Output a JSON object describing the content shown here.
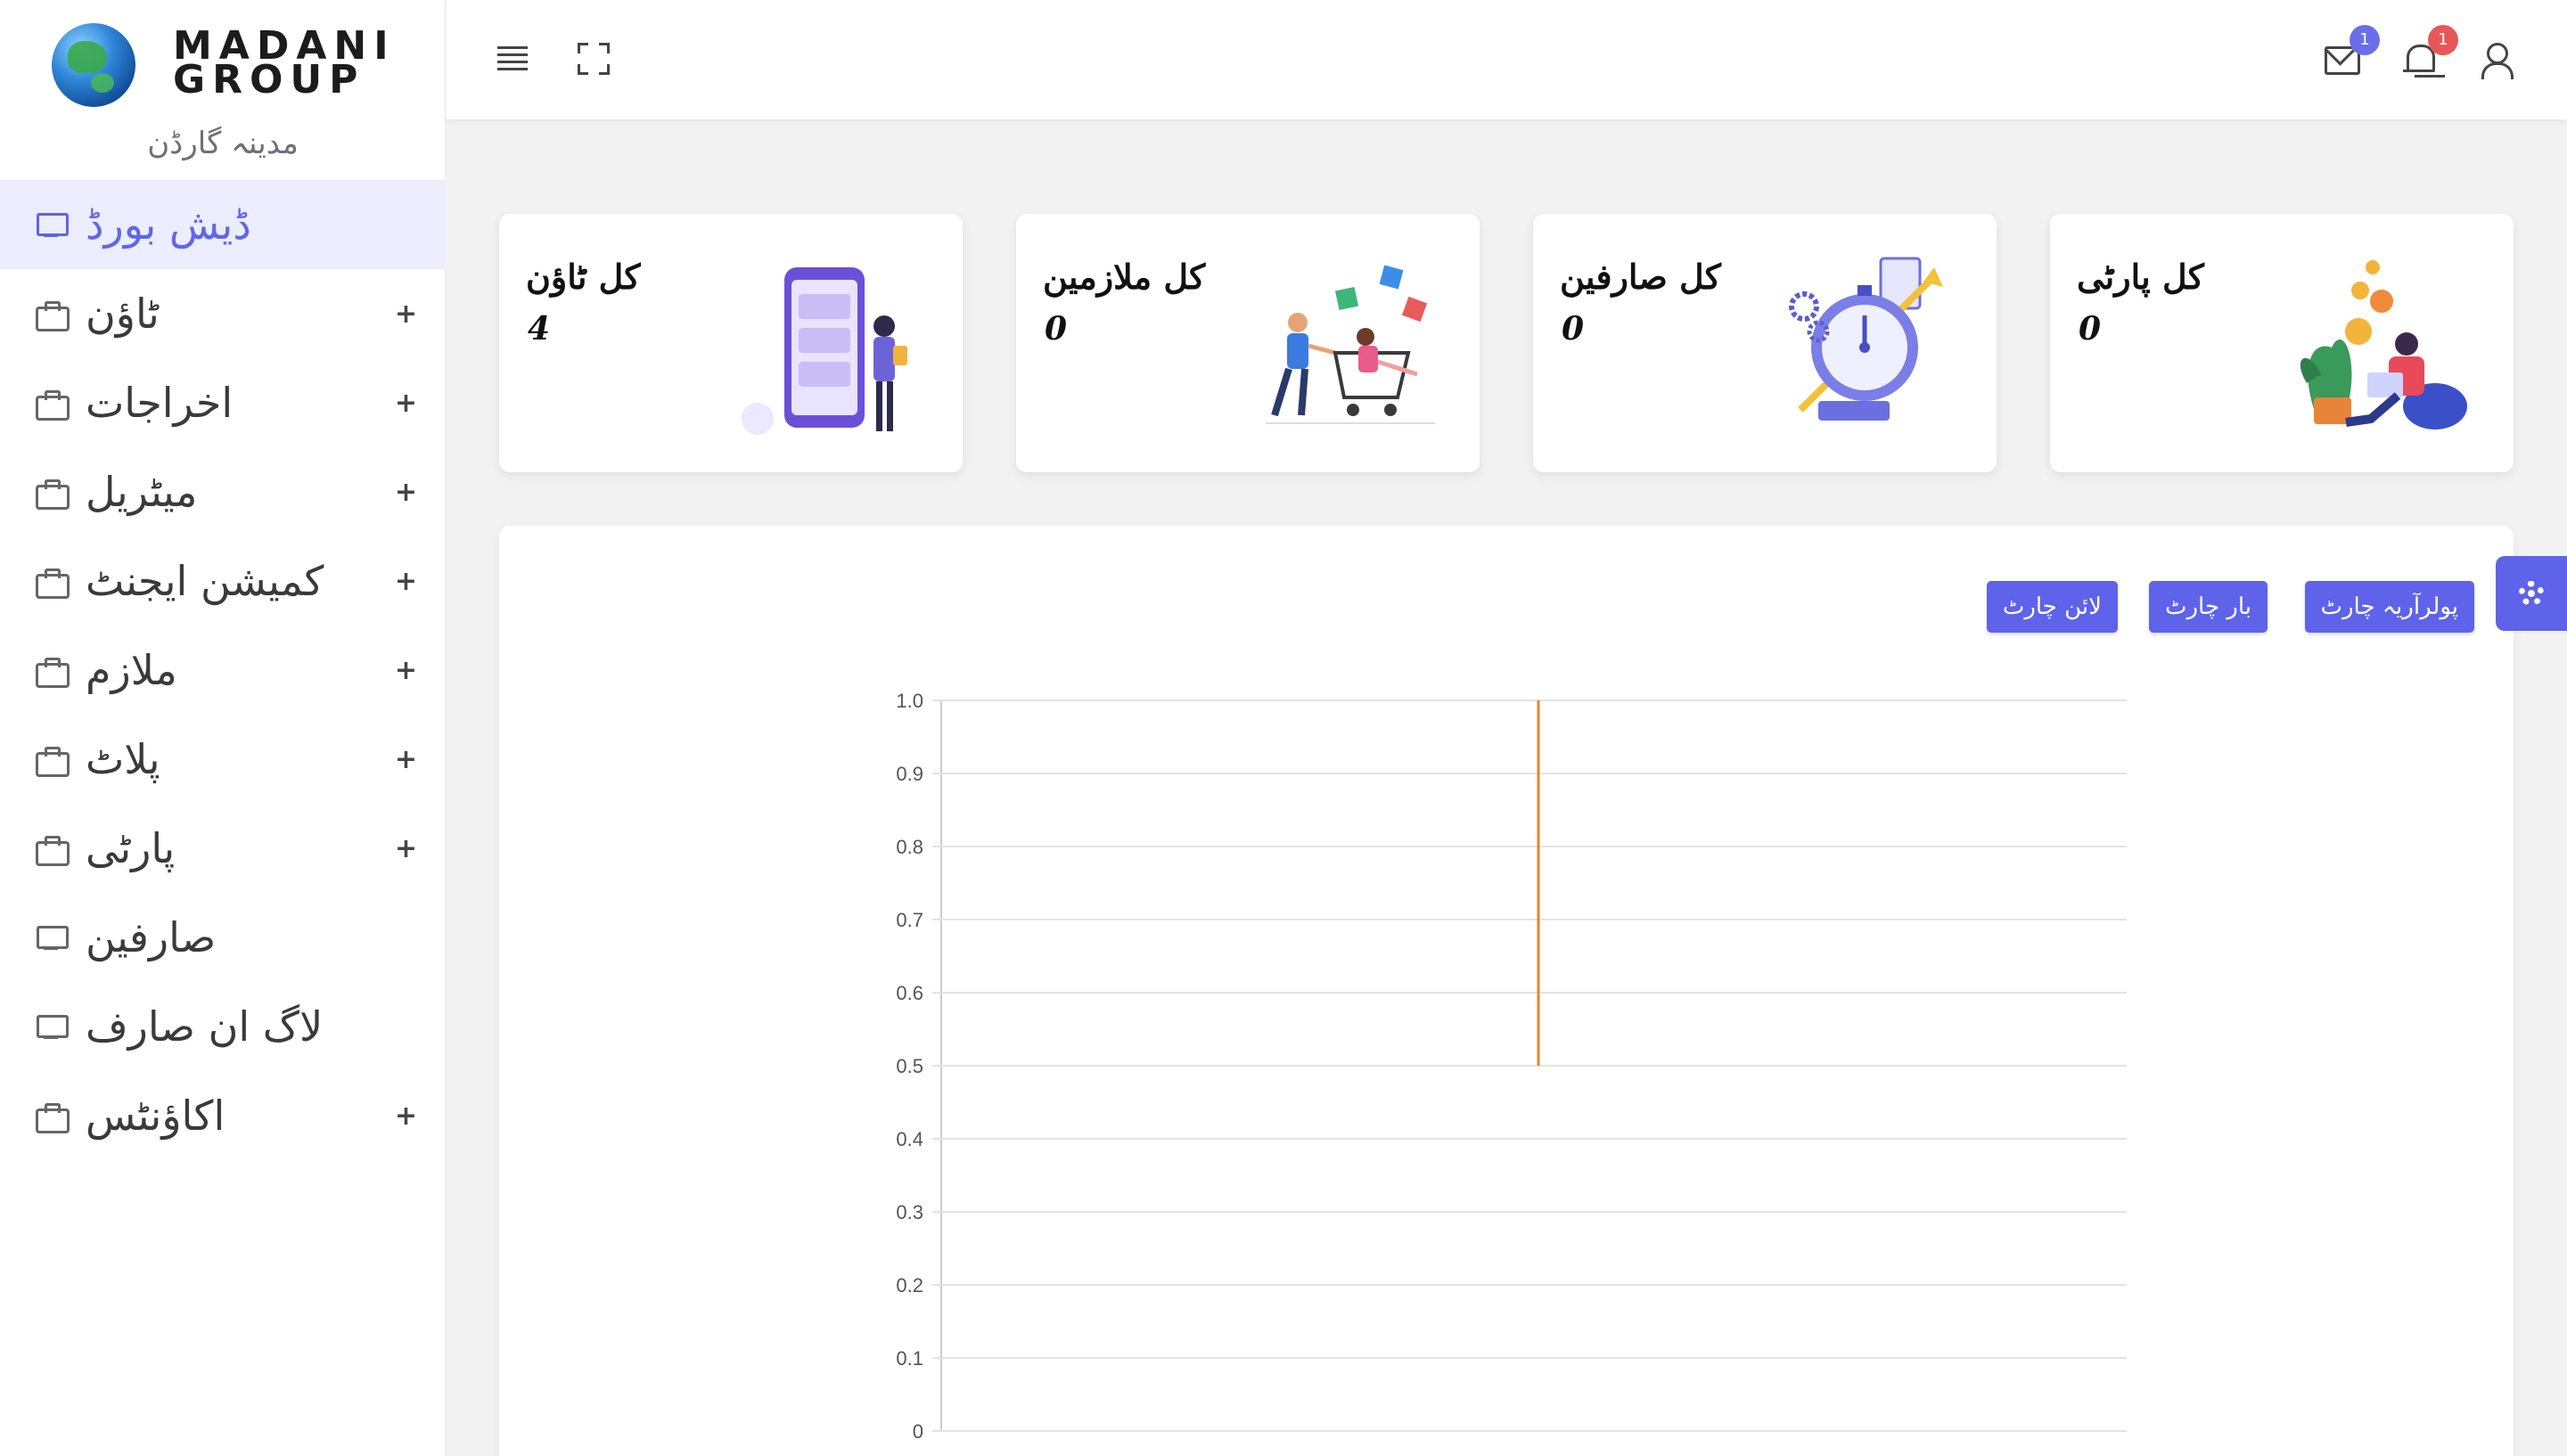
{
  "sidebar": {
    "brand_line1": "MADANI",
    "brand_line2": "GROUP",
    "subtitle": "مدینہ گارڈن",
    "items": [
      {
        "label": "ڈیش بورڈ",
        "icon": "monitor-icon",
        "active": true,
        "expandable": false
      },
      {
        "label": "ٹاؤن",
        "icon": "briefcase-icon",
        "expandable": true
      },
      {
        "label": "اخراجات",
        "icon": "briefcase-icon",
        "expandable": true
      },
      {
        "label": "میٹریل",
        "icon": "briefcase-icon",
        "expandable": true
      },
      {
        "label": "کمیشن ایجنٹ",
        "icon": "briefcase-icon",
        "expandable": true
      },
      {
        "label": "ملازم",
        "icon": "briefcase-icon",
        "expandable": true
      },
      {
        "label": "پلاٹ",
        "icon": "briefcase-icon",
        "expandable": true
      },
      {
        "label": "پارٹی",
        "icon": "briefcase-icon",
        "expandable": true
      },
      {
        "label": "صارفین",
        "icon": "monitor-icon",
        "expandable": false
      },
      {
        "label": "لاگ ان صارف",
        "icon": "monitor-icon",
        "expandable": false
      },
      {
        "label": "اکاؤنٹس",
        "icon": "briefcase-icon",
        "expandable": true
      }
    ],
    "expand_symbol": "+"
  },
  "topbar": {
    "mail_badge": "1",
    "bell_badge": "1",
    "icons": [
      "menu-icon",
      "fullscreen-icon",
      "mail-icon",
      "bell-icon",
      "user-icon"
    ]
  },
  "cards": [
    {
      "title": "کل ٹاؤن",
      "value": "4",
      "illustration": "phone-app-illustration"
    },
    {
      "title": "کل ملازمین",
      "value": "0",
      "illustration": "shopping-cart-illustration"
    },
    {
      "title": "کل صارفین",
      "value": "0",
      "illustration": "stopwatch-illustration"
    },
    {
      "title": "کل پارٹی",
      "value": "0",
      "illustration": "coins-plant-illustration"
    }
  ],
  "chart_buttons": {
    "polar": "پولرآریہ چارٹ",
    "bar": "بار چارٹ",
    "line": "لائن چارٹ"
  },
  "colors": {
    "accent": "#5e63e9",
    "line_series": "#e8842c",
    "badge_mail": "#6a6ee8",
    "badge_bell": "#e85757"
  },
  "chart_data": {
    "type": "line",
    "ylim": [
      0,
      1.0
    ],
    "yticks": [
      "1.0",
      "0.9",
      "0.8",
      "0.7",
      "0.6",
      "0.5",
      "0.4",
      "0.3",
      "0.2",
      "0.1",
      "0"
    ],
    "grid": true,
    "series": [
      {
        "color": "#e8842c",
        "segment": [
          {
            "y": 0.5
          },
          {
            "y": 1.0
          }
        ]
      }
    ],
    "legend_position": "bottom"
  }
}
